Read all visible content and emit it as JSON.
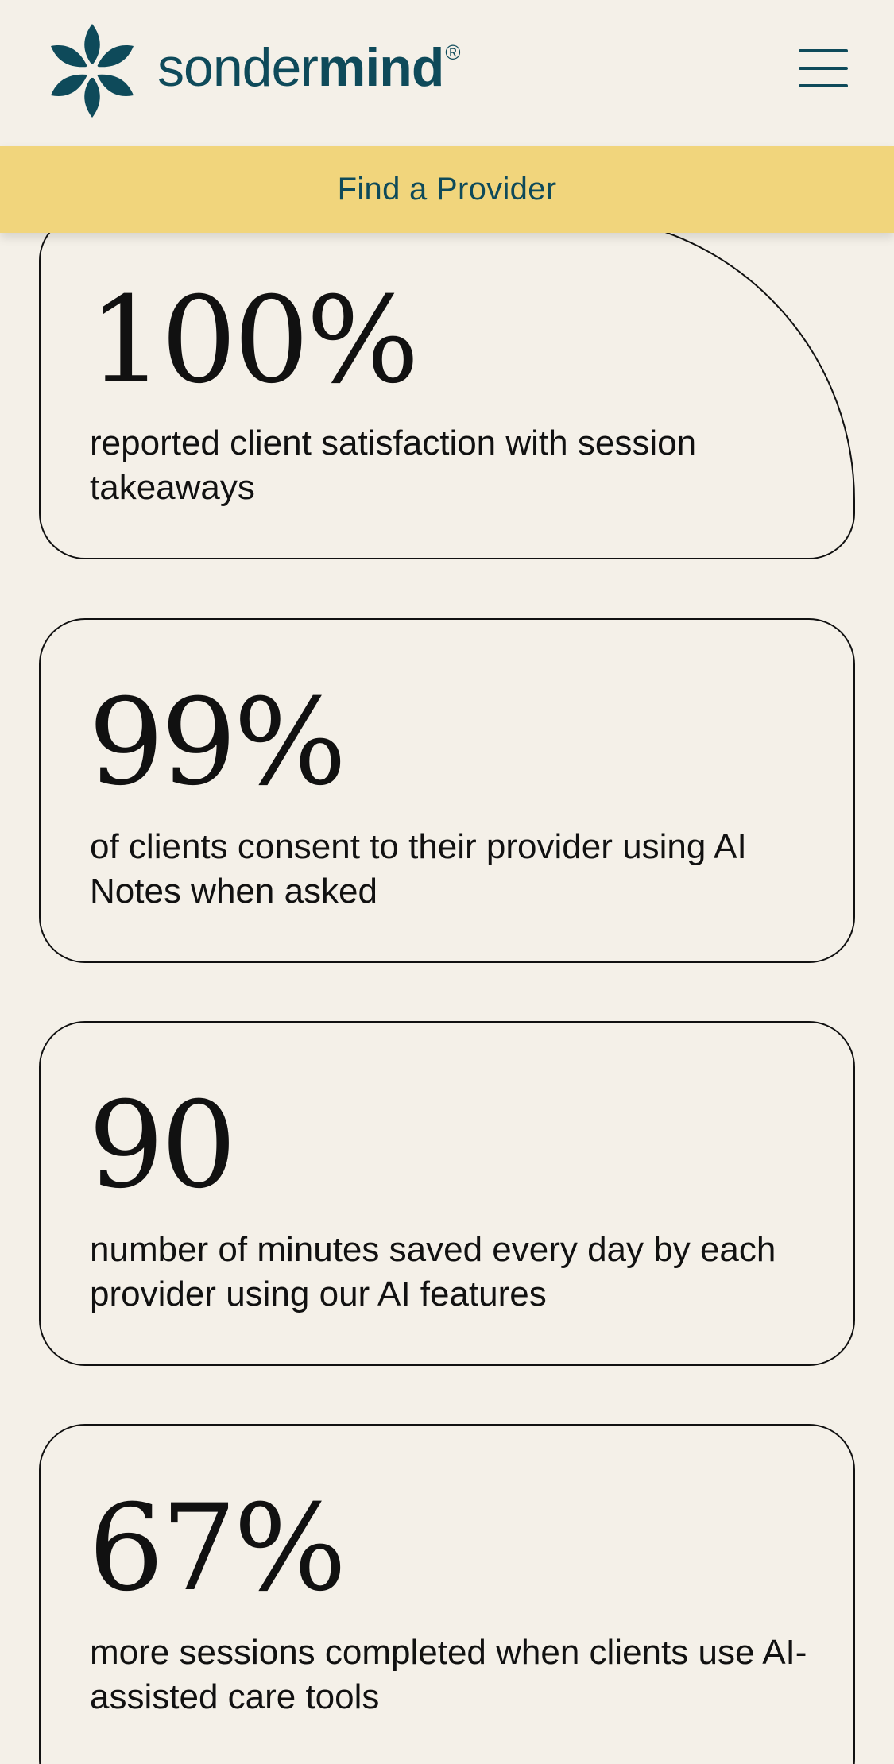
{
  "header": {
    "logo": {
      "icon": "sondermind-flower-logo-icon",
      "wordmark_light": "sonder",
      "wordmark_bold": "mind",
      "registered_mark": "®"
    },
    "menu_icon": "hamburger-menu-icon"
  },
  "cta": {
    "label": "Find a Provider"
  },
  "stats": [
    {
      "value": "100%",
      "description": "reported client satisfaction with session takeaways"
    },
    {
      "value": "99%",
      "description": "of clients consent to their provider using AI Notes when asked"
    },
    {
      "value": "90",
      "description": "number of minutes saved every day by each provider using our AI features"
    },
    {
      "value": "67%",
      "description": "more sessions completed when clients use AI-assisted care tools"
    }
  ],
  "colors": {
    "background": "#f4f0e8",
    "brand_teal": "#0e4a5a",
    "cta_yellow": "#f1d57c",
    "text": "#111111"
  }
}
